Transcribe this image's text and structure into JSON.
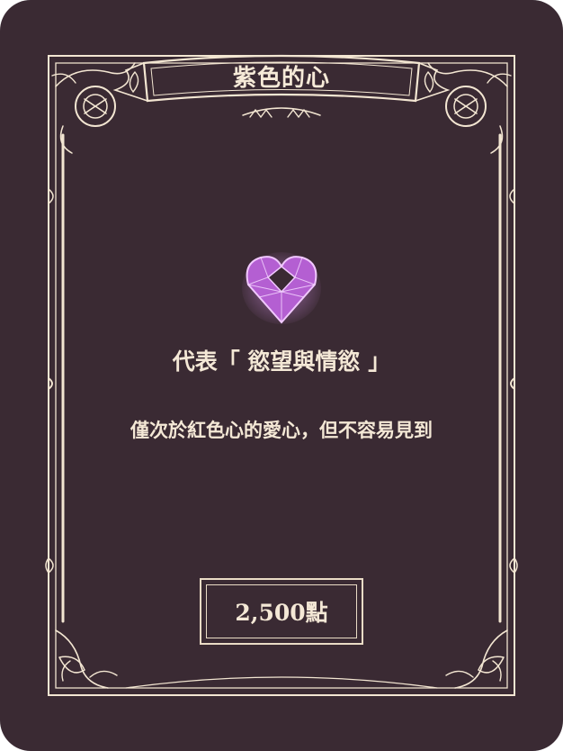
{
  "card": {
    "title": "紫色的心",
    "subtitle": "代表「 慾望與情慾 」",
    "description": "僅次於紅色心的愛心，但不容易見到",
    "price": "2,500點",
    "colors": {
      "background": "#3a2a33",
      "ornament": "#f3e6d2",
      "gem": "#c86be0"
    },
    "icons": {
      "gem": "purple-heart-gem-icon"
    }
  }
}
